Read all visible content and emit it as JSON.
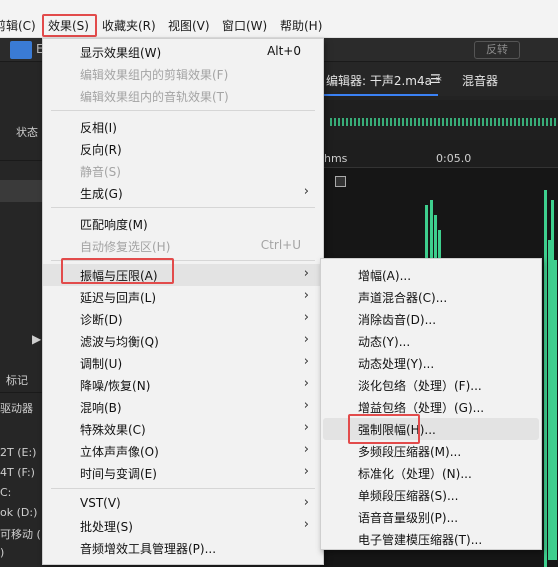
{
  "menubar": {
    "items": [
      {
        "label": "剪辑(C)"
      },
      {
        "label": "效果(S)"
      },
      {
        "label": "收藏夹(R)"
      },
      {
        "label": "视图(V)"
      },
      {
        "label": "窗口(W)"
      },
      {
        "label": "帮助(H)"
      }
    ]
  },
  "toolbar": {
    "left_letter": "E",
    "right_button": "反转"
  },
  "left_panel": {
    "status_label": "状态",
    "marker_label": "标记",
    "driver_label": "驱动器",
    "drives": [
      "2T (E:)",
      "4T (F:)",
      "C:",
      "ok (D:)",
      "可移动 (",
      ")"
    ]
  },
  "editor": {
    "tab_editor": "编辑器: 干声2.m4a *",
    "tab_menu_icon": "hamburger-icon",
    "tab_mixer": "混音器",
    "timeline_start": "hms",
    "timeline_mark": "0:05.0"
  },
  "main_menu": {
    "items": [
      {
        "label": "显示效果组(W)",
        "shortcut": "Alt+0",
        "disabled": false,
        "submenu": false
      },
      {
        "label": "编辑效果组内的剪辑效果(F)",
        "shortcut": "",
        "disabled": true,
        "submenu": false
      },
      {
        "label": "编辑效果组内的音轨效果(T)",
        "shortcut": "",
        "disabled": true,
        "submenu": false
      },
      {
        "label": "反相(I)",
        "shortcut": "",
        "disabled": false,
        "submenu": false
      },
      {
        "label": "反向(R)",
        "shortcut": "",
        "disabled": false,
        "submenu": false
      },
      {
        "label": "静音(S)",
        "shortcut": "",
        "disabled": true,
        "submenu": false
      },
      {
        "label": "生成(G)",
        "shortcut": "",
        "disabled": false,
        "submenu": true
      },
      {
        "label": "匹配响度(M)",
        "shortcut": "",
        "disabled": false,
        "submenu": false
      },
      {
        "label": "自动修复选区(H)",
        "shortcut": "Ctrl+U",
        "disabled": true,
        "submenu": false
      },
      {
        "label": "振幅与压限(A)",
        "shortcut": "",
        "disabled": false,
        "submenu": true
      },
      {
        "label": "延迟与回声(L)",
        "shortcut": "",
        "disabled": false,
        "submenu": true
      },
      {
        "label": "诊断(D)",
        "shortcut": "",
        "disabled": false,
        "submenu": true
      },
      {
        "label": "滤波与均衡(Q)",
        "shortcut": "",
        "disabled": false,
        "submenu": true
      },
      {
        "label": "调制(U)",
        "shortcut": "",
        "disabled": false,
        "submenu": true
      },
      {
        "label": "降噪/恢复(N)",
        "shortcut": "",
        "disabled": false,
        "submenu": true
      },
      {
        "label": "混响(B)",
        "shortcut": "",
        "disabled": false,
        "submenu": true
      },
      {
        "label": "特殊效果(C)",
        "shortcut": "",
        "disabled": false,
        "submenu": true
      },
      {
        "label": "立体声声像(O)",
        "shortcut": "",
        "disabled": false,
        "submenu": true
      },
      {
        "label": "时间与变调(E)",
        "shortcut": "",
        "disabled": false,
        "submenu": true
      },
      {
        "label": "VST(V)",
        "shortcut": "",
        "disabled": false,
        "submenu": true
      },
      {
        "label": "批处理(S)",
        "shortcut": "",
        "disabled": false,
        "submenu": true
      },
      {
        "label": "音频增效工具管理器(P)...",
        "shortcut": "",
        "disabled": false,
        "submenu": false
      }
    ]
  },
  "sub_menu": {
    "items": [
      {
        "label": "增幅(A)..."
      },
      {
        "label": "声道混合器(C)..."
      },
      {
        "label": "消除齿音(D)..."
      },
      {
        "label": "动态(Y)..."
      },
      {
        "label": "动态处理(Y)..."
      },
      {
        "label": "淡化包络（处理）(F)..."
      },
      {
        "label": "增益包络（处理）(G)..."
      },
      {
        "label": "强制限幅(H)..."
      },
      {
        "label": "多频段压缩器(M)..."
      },
      {
        "label": "标准化（处理）(N)..."
      },
      {
        "label": "单频段压缩器(S)..."
      },
      {
        "label": "语音音量级别(P)..."
      },
      {
        "label": "电子管建模压缩器(T)..."
      }
    ]
  },
  "colors": {
    "highlight_border": "#e24b4b",
    "waveform": "#3ecf8e",
    "tab_underline": "#3b82f6"
  }
}
